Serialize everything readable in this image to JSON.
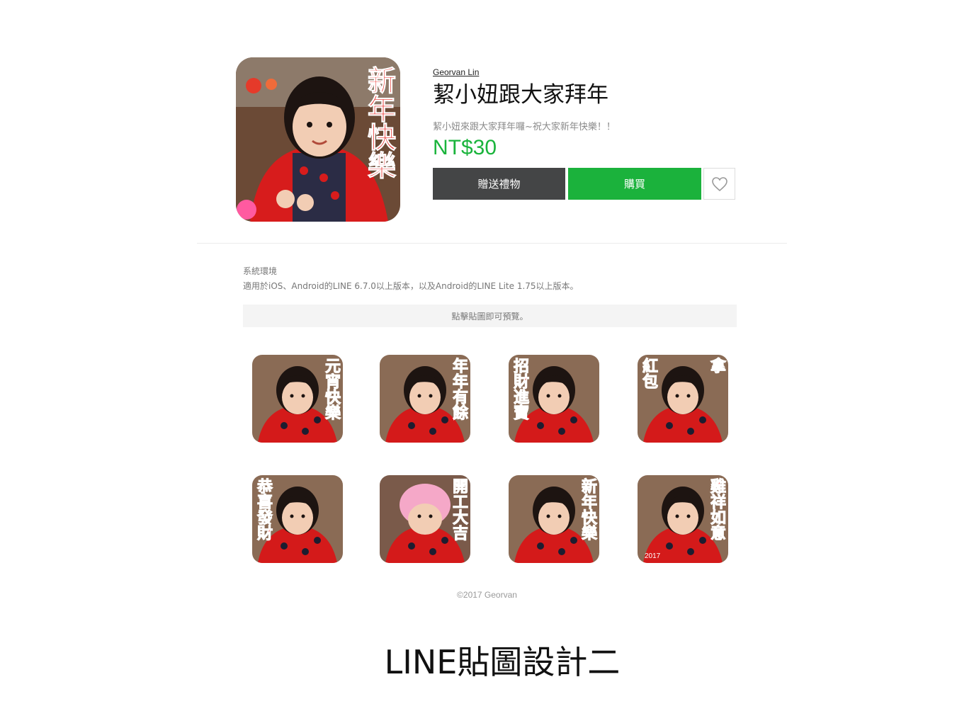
{
  "product": {
    "author": "Georvan Lin",
    "title": "絜小妞跟大家拜年",
    "description": "絜小妞來跟大家拜年囉~祝大家新年快樂！！",
    "price": "NT$30",
    "main_image_text": "新年快樂"
  },
  "buttons": {
    "gift_label": "贈送禮物",
    "buy_label": "購買",
    "favorite_icon": "heart-icon"
  },
  "environment": {
    "label": "系統環境",
    "text": "適用於iOS、Android的LINE 6.7.0以上版本，以及Android的LINE Lite 1.75以上版本。"
  },
  "preview_hint": "點擊貼圖即可預覽。",
  "stickers": [
    {
      "text_right": "元宵快樂",
      "text_left": ""
    },
    {
      "text_right": "年年有餘",
      "text_left": ""
    },
    {
      "text_right": "",
      "text_left": "招財進寶"
    },
    {
      "text_right": "拿",
      "text_left": "紅包"
    },
    {
      "text_right": "",
      "text_left": "恭喜發財"
    },
    {
      "text_right": "開工大吉",
      "text_left": ""
    },
    {
      "text_right": "新年快樂",
      "text_left": ""
    },
    {
      "text_right": "雞祥如意",
      "text_left": "",
      "year": "2017"
    }
  ],
  "footer": {
    "copyright": "©2017 Georvan"
  },
  "caption": "LINE貼圖設計二",
  "colors": {
    "price_green": "#1ab43c",
    "buy_green": "#1bb23c",
    "gift_gray": "#444546",
    "sticker_red": "#e4140e"
  }
}
